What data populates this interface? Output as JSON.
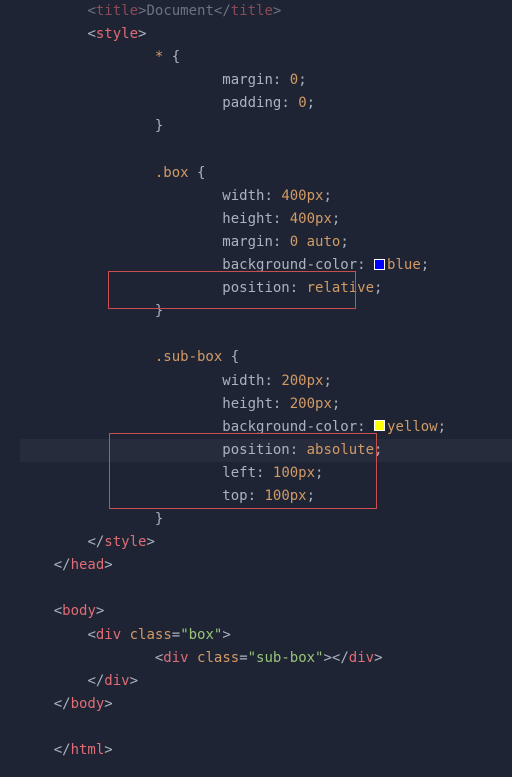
{
  "code": {
    "lines": [
      {
        "indent": 2,
        "type": "tag-pair",
        "open": "title",
        "text": "Document",
        "close": "title",
        "faded": true
      },
      {
        "indent": 2,
        "type": "open-tag",
        "name": "style"
      },
      {
        "indent": 4,
        "type": "selector-open",
        "sel": "*"
      },
      {
        "indent": 6,
        "type": "decl",
        "prop": "margin",
        "val": "0",
        "valType": "num"
      },
      {
        "indent": 6,
        "type": "decl",
        "prop": "padding",
        "val": "0",
        "valType": "num"
      },
      {
        "indent": 4,
        "type": "close-brace"
      },
      {
        "indent": 0,
        "type": "blank"
      },
      {
        "indent": 4,
        "type": "selector-open",
        "sel": ".box"
      },
      {
        "indent": 6,
        "type": "decl",
        "prop": "width",
        "val": "400px",
        "valType": "num"
      },
      {
        "indent": 6,
        "type": "decl",
        "prop": "height",
        "val": "400px",
        "valType": "num"
      },
      {
        "indent": 6,
        "type": "decl-multi",
        "prop": "margin",
        "vals": [
          "0",
          "auto"
        ]
      },
      {
        "indent": 6,
        "type": "decl-color",
        "prop": "background-color",
        "swatch": "blue",
        "val": "blue"
      },
      {
        "indent": 6,
        "type": "decl",
        "prop": "position",
        "val": "relative",
        "valType": "keyword"
      },
      {
        "indent": 4,
        "type": "close-brace"
      },
      {
        "indent": 0,
        "type": "blank"
      },
      {
        "indent": 4,
        "type": "selector-open",
        "sel": ".sub-box"
      },
      {
        "indent": 6,
        "type": "decl",
        "prop": "width",
        "val": "200px",
        "valType": "num"
      },
      {
        "indent": 6,
        "type": "decl",
        "prop": "height",
        "val": "200px",
        "valType": "num"
      },
      {
        "indent": 6,
        "type": "decl-color",
        "prop": "background-color",
        "swatch": "yellow",
        "val": "yellow"
      },
      {
        "indent": 6,
        "type": "decl",
        "prop": "position",
        "val": "absolute",
        "valType": "keyword",
        "highlight": true
      },
      {
        "indent": 6,
        "type": "decl",
        "prop": "left",
        "val": "100px",
        "valType": "num"
      },
      {
        "indent": 6,
        "type": "decl",
        "prop": "top",
        "val": "100px",
        "valType": "num"
      },
      {
        "indent": 4,
        "type": "close-brace"
      },
      {
        "indent": 2,
        "type": "close-tag",
        "name": "style"
      },
      {
        "indent": 1,
        "type": "close-tag",
        "name": "head"
      },
      {
        "indent": 0,
        "type": "blank"
      },
      {
        "indent": 1,
        "type": "open-tag",
        "name": "body"
      },
      {
        "indent": 2,
        "type": "open-tag-attr",
        "name": "div",
        "attr": "class",
        "attrVal": "box"
      },
      {
        "indent": 4,
        "type": "tag-pair-attr",
        "name": "div",
        "attr": "class",
        "attrVal": "sub-box"
      },
      {
        "indent": 2,
        "type": "close-tag",
        "name": "div"
      },
      {
        "indent": 1,
        "type": "close-tag",
        "name": "body"
      },
      {
        "indent": 0,
        "type": "blank"
      },
      {
        "indent": 1,
        "type": "close-tag",
        "name": "html"
      }
    ]
  }
}
